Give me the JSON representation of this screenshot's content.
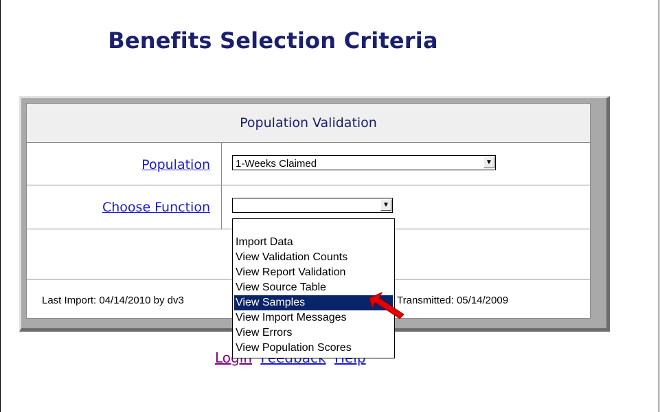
{
  "page": {
    "title": "Benefits Selection Criteria"
  },
  "panel": {
    "header": "Population Validation",
    "population_label": "Population",
    "population_value": "1-Weeks Claimed",
    "function_label": "Choose Function",
    "function_value": "",
    "last_import": "Last Import: 04/14/2010 by dv3",
    "transmitted": "Transmitted: 05/14/2009"
  },
  "dropdown": {
    "options": [
      "Import Data",
      "View Validation Counts",
      "View Report Validation",
      "View Source Table",
      "View Samples",
      "View Import Messages",
      "View Errors",
      "View Population Scores"
    ],
    "selected": "View Samples"
  },
  "links": {
    "login": "Login",
    "feedback": "Feedback",
    "help": "Help"
  },
  "colors": {
    "title": "#1a1f6e",
    "link": "#1a1ad0",
    "visited_link": "#800080",
    "selection": "#0a246a",
    "pointer_arrow": "#e60000"
  }
}
